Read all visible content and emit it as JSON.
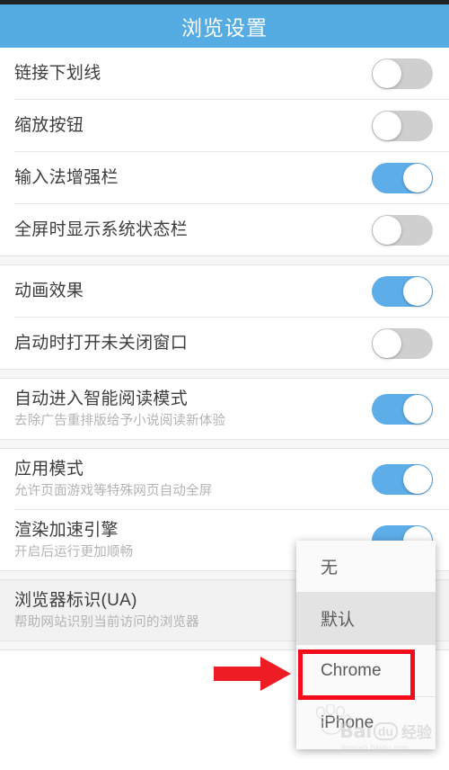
{
  "header": {
    "title": "浏览设置"
  },
  "settings": {
    "groups": [
      {
        "rows": [
          {
            "title": "链接下划线",
            "subtitle": "",
            "control": "toggle",
            "state": "off"
          },
          {
            "title": "缩放按钮",
            "subtitle": "",
            "control": "toggle",
            "state": "off"
          },
          {
            "title": "输入法增强栏",
            "subtitle": "",
            "control": "toggle",
            "state": "on"
          },
          {
            "title": "全屏时显示系统状态栏",
            "subtitle": "",
            "control": "toggle",
            "state": "off"
          }
        ]
      },
      {
        "rows": [
          {
            "title": "动画效果",
            "subtitle": "",
            "control": "toggle",
            "state": "on"
          },
          {
            "title": "启动时打开未关闭窗口",
            "subtitle": "",
            "control": "toggle",
            "state": "off"
          }
        ]
      },
      {
        "rows": [
          {
            "title": "自动进入智能阅读模式",
            "subtitle": "去除广告重排版给予小说阅读新体验",
            "control": "toggle",
            "state": "on"
          }
        ]
      },
      {
        "rows": [
          {
            "title": "应用模式",
            "subtitle": "允许页面游戏等特殊网页自动全屏",
            "control": "toggle",
            "state": "on"
          },
          {
            "title": "渲染加速引擎",
            "subtitle": "开启后运行更加顺畅",
            "control": "toggle",
            "state": "on"
          }
        ]
      },
      {
        "rows": [
          {
            "title": "浏览器标识(UA)",
            "subtitle": "帮助网站识别当前访问的浏览器",
            "control": "none",
            "state": "pressed"
          }
        ]
      }
    ]
  },
  "dropdown": {
    "name": "ua-options-menu",
    "options": [
      {
        "label": "无",
        "highlighted": false,
        "outlined": false
      },
      {
        "label": "默认",
        "highlighted": true,
        "outlined": false
      },
      {
        "label": "Chrome",
        "highlighted": false,
        "outlined": true
      },
      {
        "label": "iPhone",
        "highlighted": false,
        "outlined": false
      }
    ]
  },
  "annotations": {
    "arrow_label": "red-pointer-arrow",
    "highlight_label": "red-highlight-box",
    "highlight_color": "#f40c1a",
    "arrow_color": "#ee1c25"
  },
  "watermark": {
    "brand": "Bai",
    "badge": "du",
    "suffix": "经验",
    "url": "jingyan.baidu.com"
  },
  "colors": {
    "header_bg": "#55ace3",
    "toggle_on": "#5dade8",
    "toggle_off": "#cfcfcf",
    "text_primary": "#3d3d3d",
    "text_secondary": "#b3b3b3"
  }
}
